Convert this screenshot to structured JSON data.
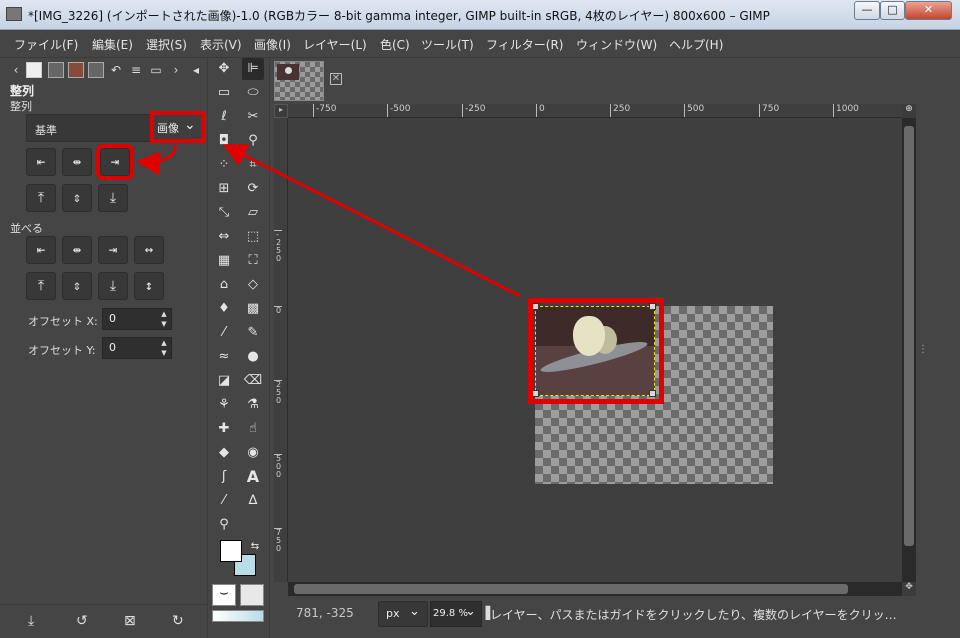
{
  "window": {
    "title": "*[IMG_3226] (インポートされた画像)-1.0 (RGBカラー 8-bit gamma integer, GIMP built-in sRGB, 4枚のレイヤー) 800x600 – GIMP",
    "minimize": "—",
    "maximize": "□",
    "close": "✕"
  },
  "menu": [
    "ファイル(F)",
    "編集(E)",
    "選択(S)",
    "表示(V)",
    "画像(I)",
    "レイヤー(L)",
    "色(C)",
    "ツール(T)",
    "フィルター(R)",
    "ウィンドウ(W)",
    "ヘルプ(H)"
  ],
  "dock": {
    "title": "整列",
    "align_label": "整列",
    "relative_to_label": "基準",
    "relative_to_value": "画像",
    "distribute_label": "並べる",
    "offset_x_label": "オフセット X:",
    "offset_x_value": "0",
    "offset_y_label": "オフセット Y:",
    "offset_y_value": "0",
    "align_buttons": [
      "align-left",
      "align-hcenter",
      "align-right",
      "align-top",
      "align-vcenter",
      "align-bottom"
    ],
    "distribute_buttons": [
      "dist-left",
      "dist-hcenter",
      "dist-right",
      "dist-hspace",
      "dist-top",
      "dist-vcenter",
      "dist-bottom",
      "dist-vspace"
    ]
  },
  "rulers": {
    "horizontal": [
      "-750",
      "-500",
      "-250",
      "0",
      "250",
      "500",
      "750",
      "1000"
    ],
    "vertical": [
      "-250",
      "0",
      "250",
      "500",
      "750"
    ]
  },
  "status": {
    "coords": "781, -325",
    "unit": "px",
    "zoom": "29.8 %",
    "message": "レイヤー、パスまたはガイドをクリックしたり、複数のレイヤーをクリッ…"
  },
  "colors": {
    "annotation": "#e00000",
    "background": "#454545",
    "bg_color_swatch": "#b8dde8"
  }
}
